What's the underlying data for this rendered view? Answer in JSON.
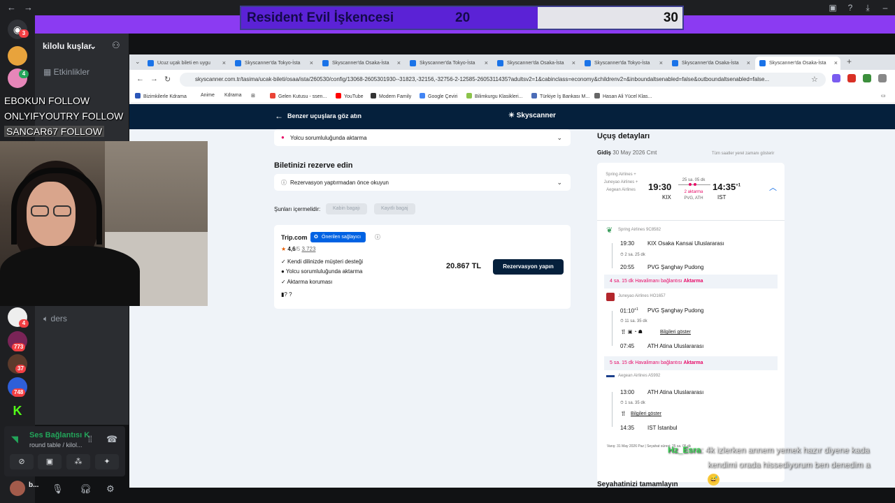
{
  "overlay": {
    "game_title": "Resident Evil İşkencesi",
    "score_left": "20",
    "score_right": "30",
    "follows": [
      "EBOKUN  FOLLOW",
      "ONLYIFYOUTRY  FOLLOW",
      "SANCAR67  FOLLOW"
    ]
  },
  "discord": {
    "server_name": "kilolu kuşlar",
    "events_label": "Etkinlikler",
    "voice_channel": "ders",
    "badges": [
      "3",
      "4",
      "773",
      "37",
      "748",
      "4"
    ],
    "voice_status": "Ses Bağlantısı K",
    "voice_sub": "round table / kilol...",
    "user_name": "b..."
  },
  "browser": {
    "tabs": [
      "Ucuz uçak bileti en uygu",
      "Skyscanner'da Tokyo-İsta",
      "Skyscanner'da Osaka-İsta",
      "Skyscanner'da Tokyo-İsta",
      "Skyscanner'da Osaka-İsta",
      "Skyscanner'da Tokyo-İsta",
      "Skyscanner'da Osaka-İsta",
      "Skyscanner'da Osaka-İsta"
    ],
    "url": "skyscanner.com.tr/tasima/ucak-bileti/osaa/ista/260530/config/13068-2605301930--31823,-32156,-32756-2-12585-2605311435?adultsv2=1&cabinclass=economy&childrenv2=&inboundaltsenabled=false&outboundaltsenabled=false...",
    "bookmarks": [
      "Bizimkilerle Kdrama",
      "Anime",
      "Kdrama",
      "Gelen Kutusu - ssen...",
      "YouTube",
      "Modern Family",
      "Google Çeviri",
      "Bilimkurgu Klasikleri...",
      "Türkiye İş Bankası M...",
      "Hasan Ali Yücel Klas..."
    ],
    "colors": {
      "header": "#05203c",
      "accent": "#0062e3",
      "warning": "#e70866"
    }
  },
  "skyscanner": {
    "back_label": "Benzer uçuşlara göz atın",
    "logo": "Skyscanner",
    "transfer_notice": "Yolcu sorumluluğunda aktarma",
    "book_heading": "Biletinizi rezerve edin",
    "read_before": "Rezervasyon yaptırmadan önce okuyun",
    "includes_label": "Şunları içermelidir:",
    "filter1": "Kabin bagajı",
    "filter2": "Kayıtlı bagaj",
    "provider": "Trip.com",
    "recommended": "Önerilen sağlayıcı",
    "rating": "4,6",
    "rating_scale": "/5",
    "reviews": "3.723",
    "features": [
      "Kendi dilinizde müşteri desteği",
      "Yolcu sorumluluğunda aktarma",
      "Aktarma koruması"
    ],
    "bag_info": "? ?",
    "price": "20.867 TL",
    "reserve_button": "Rezervasyon yapın",
    "details_title": "Uçuş detayları",
    "outbound_label": "Gidiş",
    "outbound_date": "30 May 2026 Cmt",
    "local_time_note": "Tüm saatler yerel zamanı gösterir",
    "airlines_summary": "Spring Airlines + Juneyao Airlines + Aegean Airlines",
    "dep_time": "19:30",
    "dep_code": "KIX",
    "arr_time": "14:35",
    "arr_sup": "+1",
    "arr_code": "IST",
    "duration": "25 sa. 05 dk",
    "stops": "2 aktarma",
    "stop_codes": "PVG, ATH",
    "segments": [
      {
        "airline": "Spring Airlines 9C8582",
        "t1": "19:30",
        "p1": "KIX Osaka Kansai Uluslararası",
        "dur": "2 sa. 25 dk",
        "t2": "20:55",
        "p2": "PVG Şanghay Pudong"
      },
      {
        "airline": "Juneyao Airlines HO1657",
        "t1": "01:10",
        "t1sup": "+1",
        "p1": "PVG Şanghay Pudong",
        "dur": "11 sa. 35 dk",
        "info": "Bilgileri göster",
        "t2": "07:45",
        "p2": "ATH Atina Uluslararası"
      },
      {
        "airline": "Aegean Airlines A5992",
        "t1": "13:00",
        "p1": "ATH Atina Uluslararası",
        "dur": "1 sa. 35 dk",
        "info": "Bilgileri göster",
        "t2": "14:35",
        "p2": "IST İstanbul"
      }
    ],
    "layovers": [
      {
        "time": "4 sa. 15 dk",
        "text": "Havalimanı bağlantısı",
        "tag": "Aktarma"
      },
      {
        "time": "5 sa. 15 dk",
        "text": "Havalimanı bağlantısı",
        "tag": "Aktarma"
      }
    ],
    "arrival_note": "Varış: 31 May 2026 Paz",
    "arrival_sep": "|",
    "arrival_note2": "Seyahat süresi: 25 sa. 05 dk",
    "enjoy": "Seyahatinizi tamamlayın"
  },
  "chat": {
    "name": "Hz_Esra",
    "line1": ": 4k izlerken annem yemek hazır diyene kada",
    "line2": "kendimi orada hissediyorum ben denedim a",
    "emoji": "😅"
  }
}
